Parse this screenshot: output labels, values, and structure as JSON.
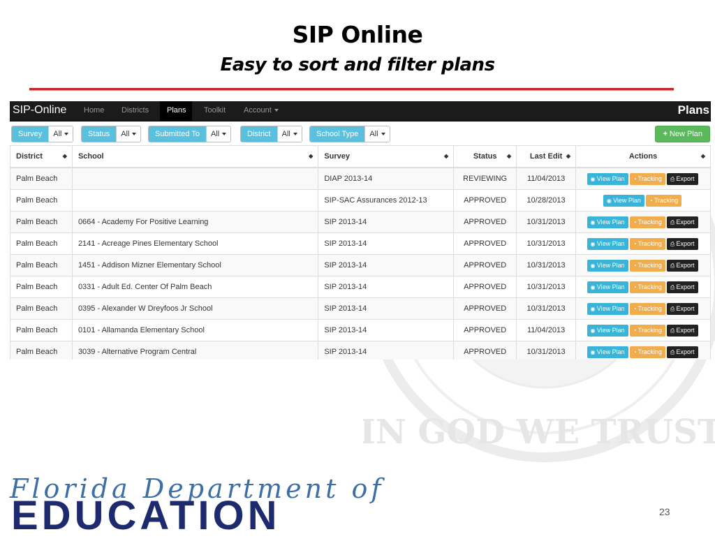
{
  "slide": {
    "title": "SIP Online",
    "subtitle": "Easy to sort and filter plans",
    "page_number": "23",
    "footer_script": "Florida Department of",
    "footer_bold": "EDUCATION",
    "seal_text": "IN GOD WE TRUST"
  },
  "navbar": {
    "brand": "SIP-Online",
    "items": [
      "Home",
      "Districts",
      "Plans",
      "Toolkit",
      "Account"
    ],
    "active": "Plans",
    "page_heading": "Plans"
  },
  "filters": [
    {
      "label": "Survey",
      "value": "All"
    },
    {
      "label": "Status",
      "value": "All"
    },
    {
      "label": "Submitted To",
      "value": "All"
    },
    {
      "label": "District",
      "value": "All"
    },
    {
      "label": "School Type",
      "value": "All"
    }
  ],
  "new_plan_label": "New Plan",
  "table": {
    "headers": [
      "District",
      "School",
      "Survey",
      "Status",
      "Last Edit",
      "Actions"
    ],
    "actions": {
      "view": "View Plan",
      "tracking": "Tracking",
      "export": "Export"
    },
    "rows": [
      [
        "Palm Beach",
        "",
        "DIAP 2013-14",
        "REVIEWING",
        "11/04/2013"
      ],
      [
        "Palm Beach",
        "",
        "SIP-SAC Assurances 2012-13",
        "APPROVED",
        "10/28/2013"
      ],
      [
        "Palm Beach",
        "0664 - Academy For Positive Learning",
        "SIP 2013-14",
        "APPROVED",
        "10/31/2013"
      ],
      [
        "Palm Beach",
        "2141 - Acreage Pines Elementary School",
        "SIP 2013-14",
        "APPROVED",
        "10/31/2013"
      ],
      [
        "Palm Beach",
        "1451 - Addison Mizner Elementary School",
        "SIP 2013-14",
        "APPROVED",
        "10/31/2013"
      ],
      [
        "Palm Beach",
        "0331 - Adult Ed. Center Of Palm Beach",
        "SIP 2013-14",
        "APPROVED",
        "10/31/2013"
      ],
      [
        "Palm Beach",
        "0395 - Alexander W Dreyfoos Jr School",
        "SIP 2013-14",
        "APPROVED",
        "10/31/2013"
      ],
      [
        "Palm Beach",
        "0101 - Allamanda Elementary School",
        "SIP 2013-14",
        "APPROVED",
        "11/04/2013"
      ],
      [
        "Palm Beach",
        "3039 - Alternative Program Central",
        "SIP 2013-14",
        "APPROVED",
        "10/31/2013"
      ]
    ],
    "row_has_export": [
      true,
      false,
      true,
      true,
      true,
      true,
      true,
      true,
      true
    ]
  },
  "colors": {
    "title_rule": "#c0272d",
    "filter_label": "#5bc0de",
    "new_plan": "#5cb85c",
    "view_button": "#39b3d7",
    "tracking_button": "#f0ad4e",
    "export_button": "#222222",
    "education_text": "#1e2a6e"
  }
}
